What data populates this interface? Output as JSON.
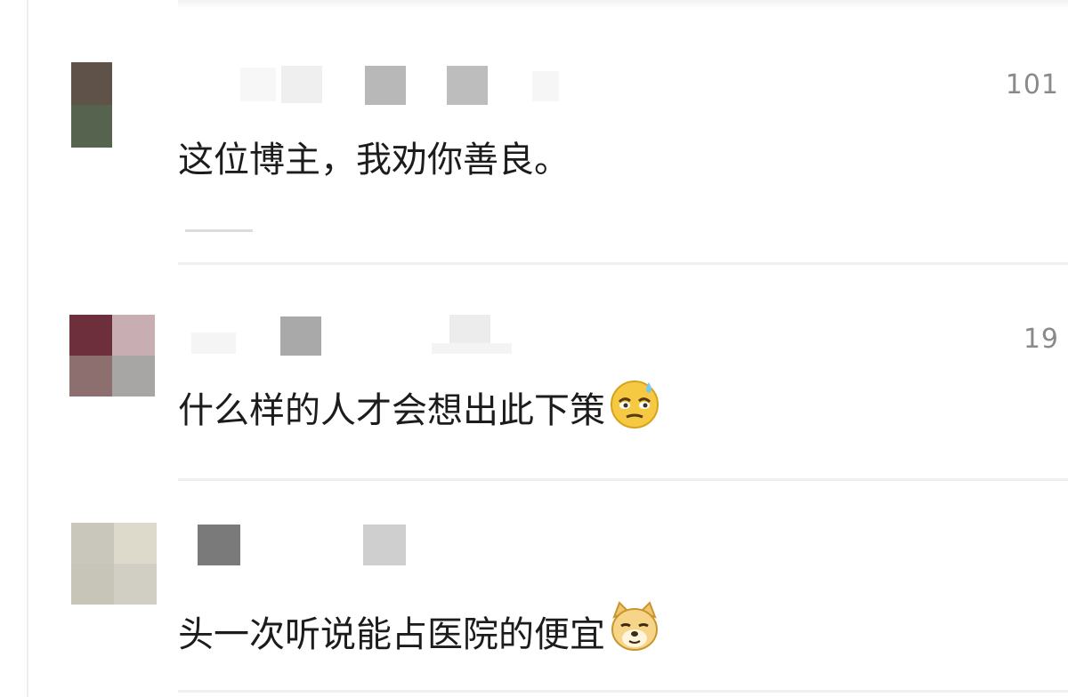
{
  "comments": [
    {
      "likes": "101",
      "text": "这位博主，我劝你善良。",
      "emoji": "",
      "avatar_colors": [
        "#5e5248",
        "#6a5d52",
        "#5a6858",
        "#4f5c4a"
      ]
    },
    {
      "likes": "19",
      "text": "什么样的人才会想出此下策",
      "emoji": "sweat-face-icon",
      "avatar_colors": [
        "#6d2f3c",
        "#c8aeb3",
        "#8d6f70",
        "#a8a6a4"
      ]
    },
    {
      "likes": "",
      "text": "头一次听说能占医院的便宜",
      "emoji": "doge-face-icon",
      "avatar_colors": [
        "#c9c7bc",
        "#dedacb",
        "#c7c4b8",
        "#d1cec4"
      ]
    }
  ]
}
